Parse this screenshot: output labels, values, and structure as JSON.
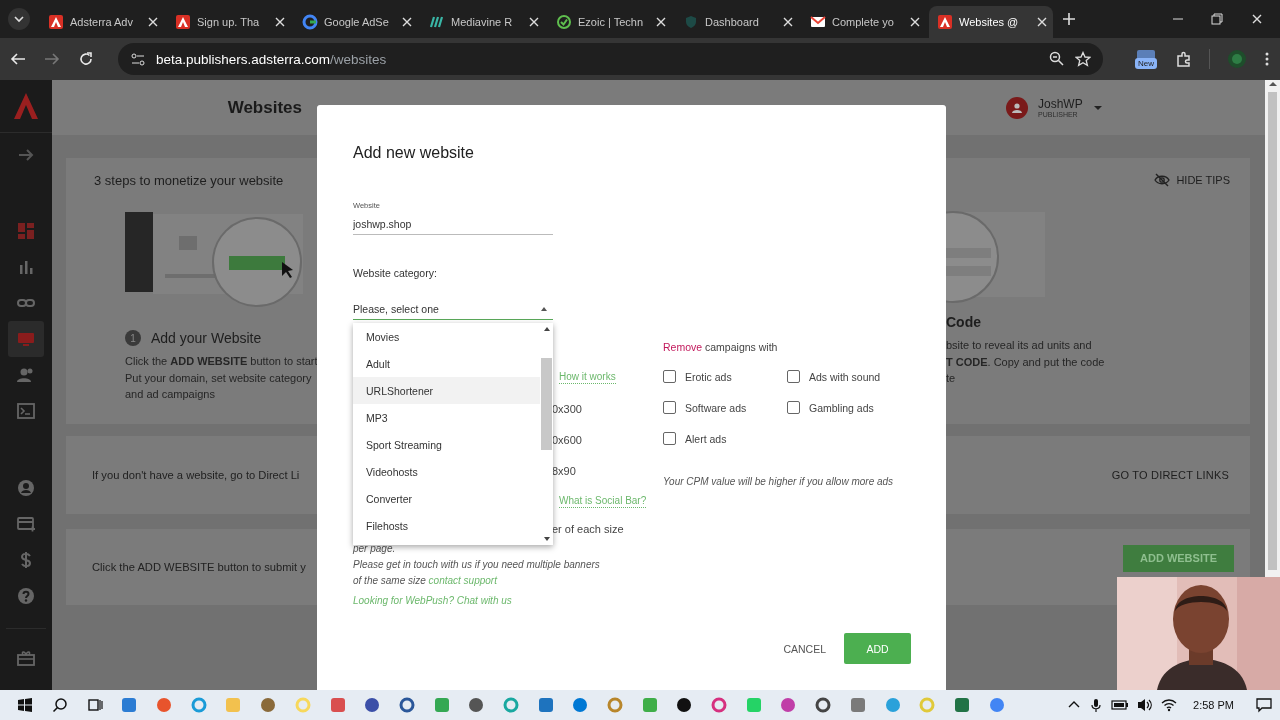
{
  "browser": {
    "tabs": [
      {
        "title": "Adsterra Adv",
        "selected": false
      },
      {
        "title": "Sign up. Tha",
        "selected": false
      },
      {
        "title": "Google AdSe",
        "selected": false
      },
      {
        "title": "Mediavine R",
        "selected": false
      },
      {
        "title": "Ezoic | Techn",
        "selected": false
      },
      {
        "title": "Dashboard",
        "selected": false
      },
      {
        "title": "Complete yo",
        "selected": false
      },
      {
        "title": "Websites @",
        "selected": true
      }
    ],
    "address_bar": {
      "host": "beta.publishers.adsterra.com",
      "path": "/websites"
    },
    "extension_badge": "New"
  },
  "sidebar": {
    "items": [
      {
        "selected": false
      },
      {
        "selected": false
      },
      {
        "selected": false
      },
      {
        "selected": false
      },
      {
        "selected": true
      },
      {
        "selected": false
      },
      {
        "selected": false
      },
      {
        "selected": false
      },
      {
        "selected": false
      },
      {
        "selected": false
      },
      {
        "selected": false
      },
      {
        "selected": false
      }
    ]
  },
  "header": {
    "title": "Websites",
    "user_name": "JoshWP",
    "user_role": "PUBLISHER"
  },
  "tips": {
    "title": "3 steps to monetize your website",
    "hide_tips": "HIDE TIPS",
    "steps": [
      {
        "number": "1",
        "title": "Add your Website",
        "lines": [
          "Click the **ADD WEBSITE** button to start",
          "Put your domain, set website category",
          "and ad campaigns"
        ]
      },
      {
        "title": "Code",
        "lines": [
          "bsite to reveal its ad units and",
          "**T CODE**. Copy and put the code",
          "te"
        ]
      }
    ]
  },
  "direct_links": {
    "text": "If you don't have a website, go to Direct Li",
    "link": "GO TO DIRECT LINKS"
  },
  "submit": {
    "text": "Click the ADD WEBSITE button to submit y",
    "button": "ADD WEBSITE"
  },
  "modal": {
    "title": "Add new website",
    "website_field": {
      "label": "Website",
      "value": "joshwp.shop"
    },
    "category": {
      "label": "Website category:",
      "placeholder": "Please, select one",
      "expanded": true,
      "options": [
        {
          "label": "Movies",
          "highlighted": false
        },
        {
          "label": "Adult",
          "highlighted": false
        },
        {
          "label": "URLShortener",
          "highlighted": true
        },
        {
          "label": "MP3",
          "highlighted": false
        },
        {
          "label": "Sport Streaming",
          "highlighted": false
        },
        {
          "label": "Videohosts",
          "highlighted": false
        },
        {
          "label": "Converter",
          "highlighted": false
        },
        {
          "label": "Filehosts",
          "highlighted": false
        }
      ]
    },
    "behind_dropdown": [
      {
        "text": "How it works",
        "kind": "link"
      },
      {
        "text": "0x300",
        "kind": "text"
      },
      {
        "text": "0x600",
        "kind": "text"
      },
      {
        "text": "8x90",
        "kind": "text"
      },
      {
        "text": "What is Social Bar?",
        "kind": "link"
      },
      {
        "text": "er of each size",
        "kind": "text"
      }
    ],
    "note_lines": [
      "per page.",
      "Please get in touch with us if you need multiple banners",
      "of the same size"
    ],
    "support_link": "contact support",
    "webpush_link": "Looking for WebPush? Chat with us",
    "restrictions": {
      "remove_word": "Remove",
      "label": "campaigns with",
      "options": [
        {
          "label": "Erotic ads",
          "checked": false
        },
        {
          "label": "Ads with sound",
          "checked": false
        },
        {
          "label": "Software ads",
          "checked": false
        },
        {
          "label": "Gambling ads",
          "checked": false
        },
        {
          "label": "Alert ads",
          "checked": false
        }
      ],
      "hint": "Your CPM value will be higher if you allow more ads"
    },
    "buttons": {
      "cancel": "CANCEL",
      "add": "ADD"
    }
  },
  "taskbar": {
    "time": "2:58 PM"
  }
}
